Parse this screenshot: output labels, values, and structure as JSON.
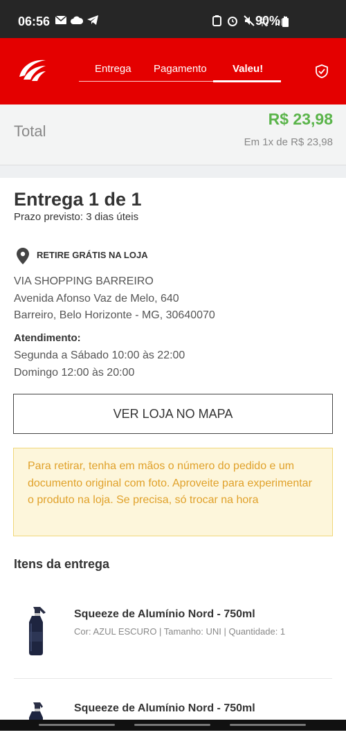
{
  "status_bar": {
    "time": "06:56",
    "battery": "90%"
  },
  "header": {
    "steps": [
      {
        "label": "Entrega"
      },
      {
        "label": "Pagamento"
      },
      {
        "label": "Valeu!"
      }
    ],
    "active_step": "Valeu!",
    "accent": "#e40000"
  },
  "total": {
    "label": "Total",
    "price": "R$ 23,98",
    "installments": "Em 1x de R$ 23,98",
    "price_color": "#5ab44a"
  },
  "delivery": {
    "title": "Entrega 1 de 1",
    "estimate": "Prazo previsto: 3 dias úteis",
    "pickup_label": "RETIRE GRÁTIS NA LOJA",
    "store_name": "VIA SHOPPING BARREIRO",
    "address_line1": "Avenida Afonso Vaz de Melo, 640",
    "address_line2": "Barreiro, Belo Horizonte - MG, 30640070",
    "hours_label": "Atendimento:",
    "hours_weekdays": "Segunda a Sábado 10:00 às 22:00",
    "hours_sunday": "Domingo 12:00 às 20:00",
    "map_button": "VER LOJA NO MAPA",
    "notice": "Para retirar, tenha em mãos o número do pedido e um documento original com foto. Aproveite para experimentar o produto na loja. Se precisa, só trocar na hora"
  },
  "items": {
    "title": "Itens da entrega",
    "list": [
      {
        "name": "Squeeze de Alumínio Nord - 750ml",
        "meta": "Cor: AZUL ESCURO | Tamanho: UNI | Quantidade: 1"
      },
      {
        "name": "Squeeze de Alumínio Nord - 750ml",
        "meta": ""
      }
    ]
  }
}
